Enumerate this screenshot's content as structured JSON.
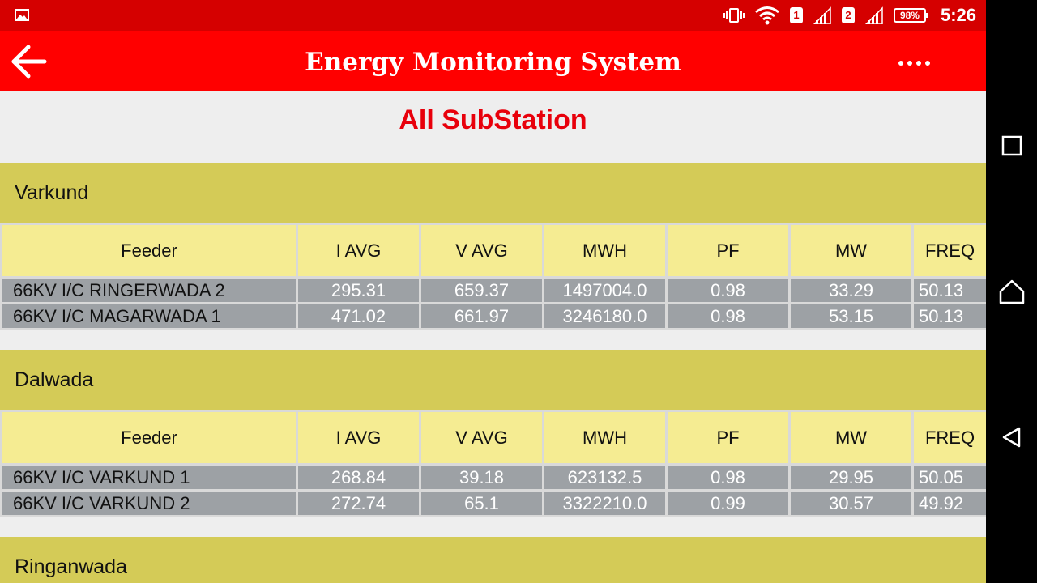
{
  "status_bar": {
    "sim1": "1",
    "sim2": "2",
    "battery": "98%",
    "time": "5:26"
  },
  "app_bar": {
    "title": "Energy Monitoring System"
  },
  "page": {
    "heading": "All SubStation"
  },
  "table_headers": [
    "Feeder",
    "I AVG",
    "V AVG",
    "MWH",
    "PF",
    "MW",
    "FREQ"
  ],
  "stations": [
    {
      "name": "Varkund",
      "rows": [
        [
          "66KV I/C RINGERWADA 2",
          "295.31",
          "659.37",
          "1497004.0",
          "0.98",
          "33.29",
          "50.13"
        ],
        [
          "66KV I/C MAGARWADA 1",
          "471.02",
          "661.97",
          "3246180.0",
          "0.98",
          "53.15",
          "50.13"
        ]
      ]
    },
    {
      "name": "Dalwada",
      "rows": [
        [
          "66KV I/C VARKUND 1",
          "268.84",
          "39.18",
          "623132.5",
          "0.98",
          "29.95",
          "50.05"
        ],
        [
          "66KV I/C VARKUND 2",
          "272.74",
          "65.1",
          "3322210.0",
          "0.99",
          "30.57",
          "49.92"
        ]
      ]
    },
    {
      "name": "Ringanwada",
      "rows": []
    }
  ],
  "colors": {
    "status_bar": "#d50000",
    "app_bar": "#ff0000",
    "heading": "#e8000b",
    "station_header": "#d4cb57",
    "table_header": "#f5ec92",
    "data_row": "#9da1a5"
  }
}
